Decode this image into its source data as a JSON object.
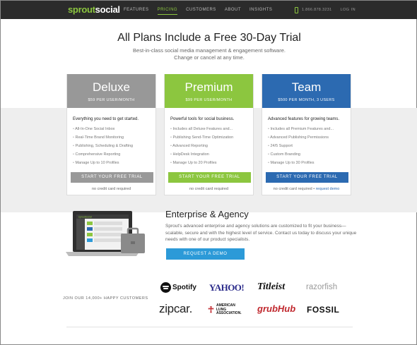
{
  "nav": {
    "logo_a": "sprout",
    "logo_b": "social",
    "links": [
      "FEATURES",
      "PRICING",
      "CUSTOMERS",
      "ABOUT",
      "INSIGHTS"
    ],
    "active": "PRICING",
    "phone": "1.866.878.3231",
    "login": "LOG IN"
  },
  "hero": {
    "title": "All Plans Include a Free 30-Day Trial",
    "sub1": "Best-in-class social media management & engagement software.",
    "sub2": "Change or cancel at any time."
  },
  "plans": [
    {
      "name": "Deluxe",
      "price": "$59 PER USER/MONTH",
      "lead": "Everything you need to get started.",
      "features": [
        "All-In-One Social Inbox",
        "Real-Time Brand Monitoring",
        "Publishing, Scheduling & Drafting",
        "Comprehensive Reporting",
        "Manage Up to 10 Profiles"
      ],
      "button": "START YOUR FREE TRIAL",
      "note": "no credit card required",
      "note_link": ""
    },
    {
      "name": "Premium",
      "price": "$99 PER USER/MONTH",
      "lead": "Powerful tools for social business.",
      "features": [
        "Includes all Deluxe Features and...",
        "Publishing Send-Time Optimization",
        "Advanced Reporting",
        "HelpDesk Integration",
        "Manage Up to 20 Profiles"
      ],
      "button": "START YOUR FREE TRIAL",
      "note": "no credit card required",
      "note_link": ""
    },
    {
      "name": "Team",
      "price": "$500 PER MONTH, 3 USERS",
      "lead": "Advanced features for growing teams.",
      "features": [
        "Includes all Premium Features and...",
        "Advanced Publishing Permissions",
        "24/5 Support",
        "Custom Branding",
        "Manage Up to 30 Profiles"
      ],
      "button": "START YOUR FREE TRIAL",
      "note": "no credit card required • ",
      "note_link": "request demo"
    }
  ],
  "enterprise": {
    "title": "Enterprise & Agency",
    "text": "Sprout's advanced enterprise and agency solutions are customized to fit your business—scalable, secure and with the highest level of service. Contact us today to discuss your unique needs with one of our product specialists.",
    "button": "REQUEST A DEMO",
    "screen_brand": "sproutsocial"
  },
  "customers": {
    "label": "JOIN OUR 14,000+ HAPPY CUSTOMERS",
    "logos": {
      "spotify": "Spotify",
      "yahoo": "YAHOO!",
      "titleist": "Titleist",
      "razorfish": "razorfish",
      "zipcar": "zipcar.",
      "lung_1": "AMERICAN",
      "lung_2": "LUNG",
      "lung_3": "ASSOCIATION.",
      "grubhub": "grubHub",
      "fossil": "FOSSIL"
    }
  },
  "colors": {
    "nav_bg": "#2b2b2b",
    "brand_green": "#8cc63f",
    "deluxe_gray": "#989898",
    "team_blue": "#2c6ab1",
    "demo_blue": "#2c9ad8"
  }
}
